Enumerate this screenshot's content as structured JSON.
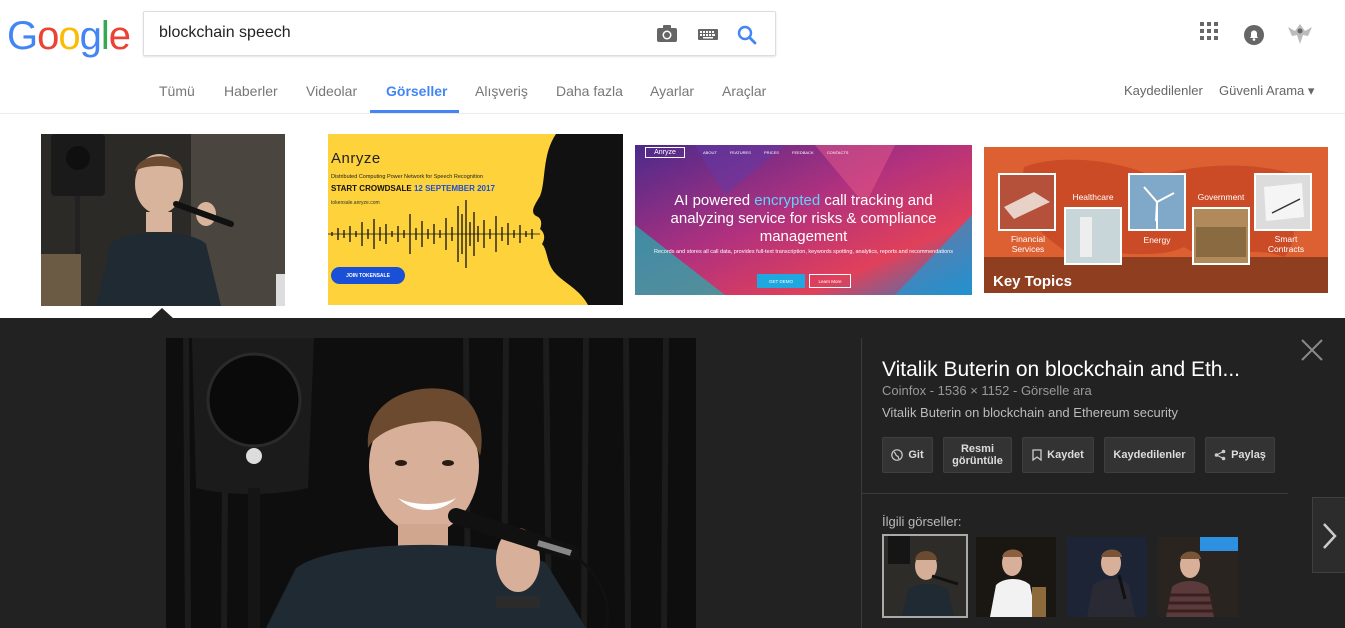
{
  "logo": {
    "letters": [
      "G",
      "o",
      "o",
      "g",
      "l",
      "e"
    ],
    "colors": [
      "#4285f4",
      "#ea4335",
      "#fbbc05",
      "#4285f4",
      "#34a853",
      "#ea4335"
    ]
  },
  "search": {
    "query": "blockchain speech",
    "icons": [
      "camera-icon",
      "keyboard-icon",
      "search-icon"
    ]
  },
  "top_right": {
    "icons": [
      "apps-grid-icon",
      "notifications-icon",
      "account-avatar"
    ]
  },
  "tabs": [
    {
      "label": "Tümü"
    },
    {
      "label": "Haberler"
    },
    {
      "label": "Videolar"
    },
    {
      "label": "Görseller",
      "active": true
    },
    {
      "label": "Alışveriş"
    },
    {
      "label": "Daha fazla"
    },
    {
      "label": "Ayarlar"
    },
    {
      "label": "Araçlar"
    }
  ],
  "tabs_right": {
    "saved": "Kaydedilenler",
    "safe_search": "Güvenli Arama ▾"
  },
  "results": {
    "anryze": {
      "brand": "Anryze",
      "subtitle": "Distributed Computing Power Network for Speech Recognition",
      "headline": "START CROWDSALE",
      "date": "12 SEPTEMBER 2017",
      "site": "tokensale.anryze.com",
      "button": "JOIN TOKENSALE"
    },
    "ai": {
      "brand": "Anryze",
      "nav": [
        "ABOUT",
        "FEATURES",
        "PRICES",
        "FEEDBACK",
        "CONTACTS"
      ],
      "line1_pre": "AI powered ",
      "line1_hl": "encrypted",
      "line1_post": " call tracking and",
      "line2": "analyzing service for risks & compliance",
      "line3": "management",
      "small": "Records and stores all call data, provides full-text transcription, keywords spotting, analytics, reports and recommendations",
      "btn1": "GET DEMO",
      "btn2": "Learn More"
    },
    "topics": {
      "title": "Key Topics",
      "items": [
        "Financial Services",
        "Healthcare",
        "Energy",
        "Government",
        "Smart Contracts"
      ]
    }
  },
  "panel": {
    "title": "Vitalik Buterin on blockchain and Eth...",
    "source": "Coinfox",
    "size": "1536 × 1152",
    "search_image": "Görselle ara",
    "description": "Vitalik Buterin on blockchain and Ethereum security",
    "buttons": {
      "visit": "Git",
      "view_line1": "Resmi",
      "view_line2": "görüntüle",
      "save": "Kaydet",
      "saved": "Kaydedilenler",
      "share": "Paylaş"
    },
    "related_label": "İlgili görseller:"
  },
  "colors": {
    "accent": "#4285f4",
    "panel_bg": "#222222",
    "anryze_yellow": "#fdd23a"
  }
}
